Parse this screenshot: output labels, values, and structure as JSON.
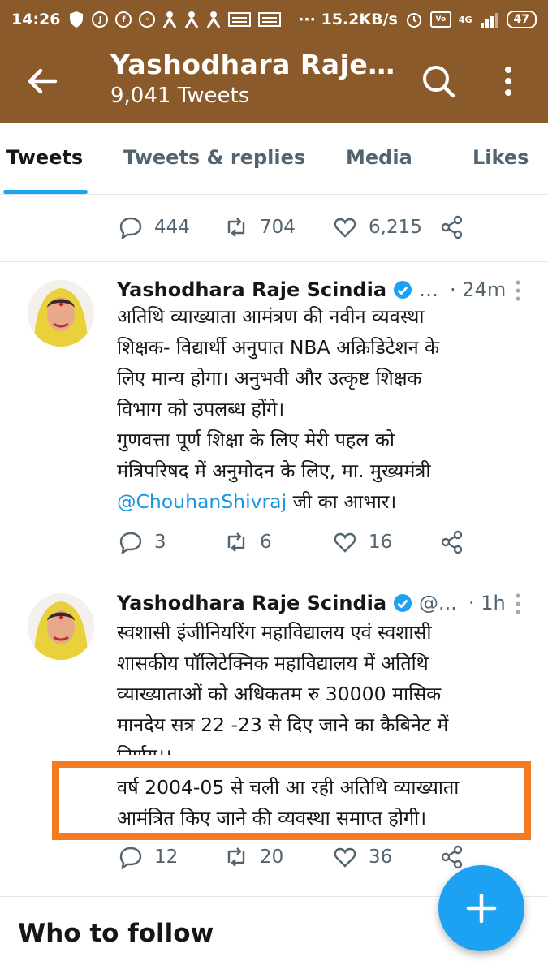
{
  "status_bar": {
    "time": "14:26",
    "notification_icons": [
      "shield-icon",
      "jio-icon",
      "facebook-icon",
      "whatsapp-icon",
      "person-icon",
      "person-icon",
      "person-icon",
      "news-icon",
      "news-icon"
    ],
    "net_speed": "··· 15.2KB/s",
    "network": "4G",
    "battery": "47"
  },
  "app_bar": {
    "title": "Yashodhara Raje…",
    "subtitle": "9,041 Tweets",
    "bg_color": "#8b5a2b"
  },
  "tabs": [
    {
      "label": "Tweets",
      "active": true
    },
    {
      "label": "Tweets & replies",
      "active": false
    },
    {
      "label": "Media",
      "active": false
    },
    {
      "label": "Likes",
      "active": false
    }
  ],
  "prev_tweet_actions": {
    "replies": "444",
    "retweets": "704",
    "likes": "6,215"
  },
  "tweets": [
    {
      "name": "Yashodhara Raje Scindia",
      "handle": "…",
      "time": "· 24m",
      "lines": [
        "अतिथि व्याख्याता आमंत्रण की नवीन व्यवस्था",
        "शिक्षक- विद्यार्थी अनुपात NBA अक्रिडिटेशन के",
        "लिए मान्य होगा। अनुभवी और उत्कृष्ट  शिक्षक",
        "विभाग को उपलब्ध होंगे।",
        "गुणवत्ता पूर्ण शिक्षा के लिए मेरी पहल को",
        "मंत्रिपरिषद में अनुमोदन के लिए, मा. मुख्यमंत्री"
      ],
      "mention": "@ChouhanShivraj",
      "mention_suffix": " जी का आभार।",
      "replies": "3",
      "retweets": "6",
      "likes": "16"
    },
    {
      "name": "Yashodhara Raje Scindia",
      "handle": "@...",
      "time": "· 1h",
      "lines": [
        "स्वशासी  इंजीनियरिंग महाविद्यालय एवं स्वशासी",
        "शासकीय पॉलिटेक्निक महाविद्यालय में अतिथि",
        "व्याख्याताओं को अधिकतम रु 30000 मासिक",
        "मानदेय सत्र 22 -23 से दिए जाने का कैबिनेट में",
        "निर्णय।।",
        "वर्ष 2004-05 से चली आ रही अतिथि व्याख्याता",
        "आमंत्रित किए जाने की व्यवस्था समाप्त होगी।"
      ],
      "replies": "12",
      "retweets": "20",
      "likes": "36"
    }
  ],
  "who_to_follow": "Who to follow",
  "colors": {
    "accent": "#1da1f2",
    "highlight": "#f47b20",
    "link": "#1b95e0",
    "muted": "#536471"
  }
}
